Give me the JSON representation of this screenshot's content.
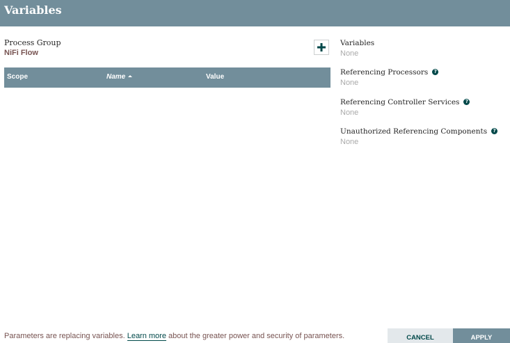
{
  "header": {
    "title": "Variables"
  },
  "process_group": {
    "label": "Process Group",
    "name": "NiFi Flow"
  },
  "table": {
    "columns": [
      {
        "label": "Scope"
      },
      {
        "label": "Name",
        "sorted": "ascending"
      },
      {
        "label": "Value"
      }
    ],
    "rows": []
  },
  "details": {
    "variables": {
      "label": "Variables",
      "value": "None"
    },
    "referencing_processors": {
      "label": "Referencing Processors",
      "value": "None",
      "help_icon": "?"
    },
    "referencing_controller_services": {
      "label": "Referencing Controller Services",
      "value": "None",
      "help_icon": "?"
    },
    "unauthorized_referencing_components": {
      "label": "Unauthorized Referencing Components",
      "value": "None",
      "help_icon": "?"
    }
  },
  "footer": {
    "text_before": "Parameters are replacing variables. ",
    "link": "Learn more",
    "text_after": " about the greater power and security of parameters.",
    "cancel_label": "CANCEL",
    "apply_label": "APPLY"
  },
  "colors": {
    "header_bg": "#728e9b",
    "accent_dark": "#004849",
    "label_brown": "#775351",
    "muted": "#aaaaaa",
    "cancel_bg": "#e3e8eb"
  }
}
